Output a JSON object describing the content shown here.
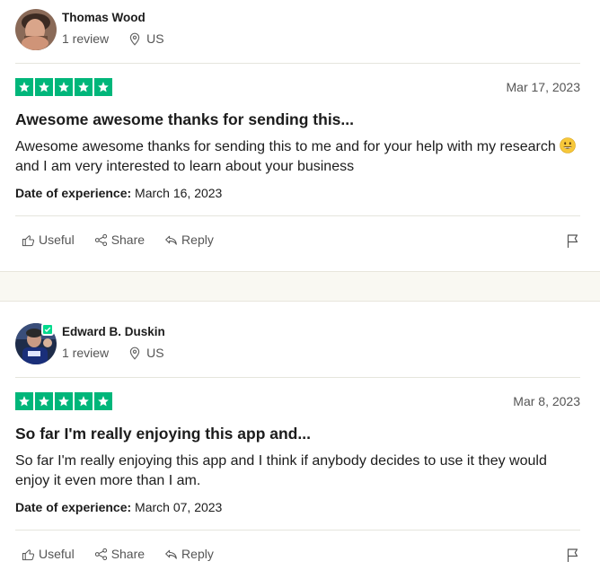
{
  "reviews": [
    {
      "reviewer_name": "Thomas Wood",
      "review_count": "1 review",
      "country": "US",
      "verified": false,
      "rating": 5,
      "date": "Mar 17, 2023",
      "title": "Awesome awesome thanks for sending this...",
      "body_part1": "Awesome awesome thanks for sending this to me and for your help with my research",
      "body_emoji": "grinning-face-emoji",
      "body_part2": " and I am very interested to learn about your business",
      "doe_label": "Date of experience:",
      "doe_value": " March 16, 2023",
      "actions": {
        "useful": "Useful",
        "share": "Share",
        "reply": "Reply"
      }
    },
    {
      "reviewer_name": "Edward B. Duskin",
      "review_count": "1 review",
      "country": "US",
      "verified": true,
      "rating": 5,
      "date": "Mar 8, 2023",
      "title": "So far I'm really enjoying this app and...",
      "body": "So far I'm really enjoying this app and I think if anybody decides to use it they would enjoy it even more than I am.",
      "doe_label": "Date of experience:",
      "doe_value": " March 07, 2023",
      "actions": {
        "useful": "Useful",
        "share": "Share",
        "reply": "Reply"
      }
    }
  ],
  "colors": {
    "star_green": "#00b67a",
    "verified_green": "#04da8d",
    "separator_bg": "#f9f8f2",
    "muted_text": "#555555"
  }
}
